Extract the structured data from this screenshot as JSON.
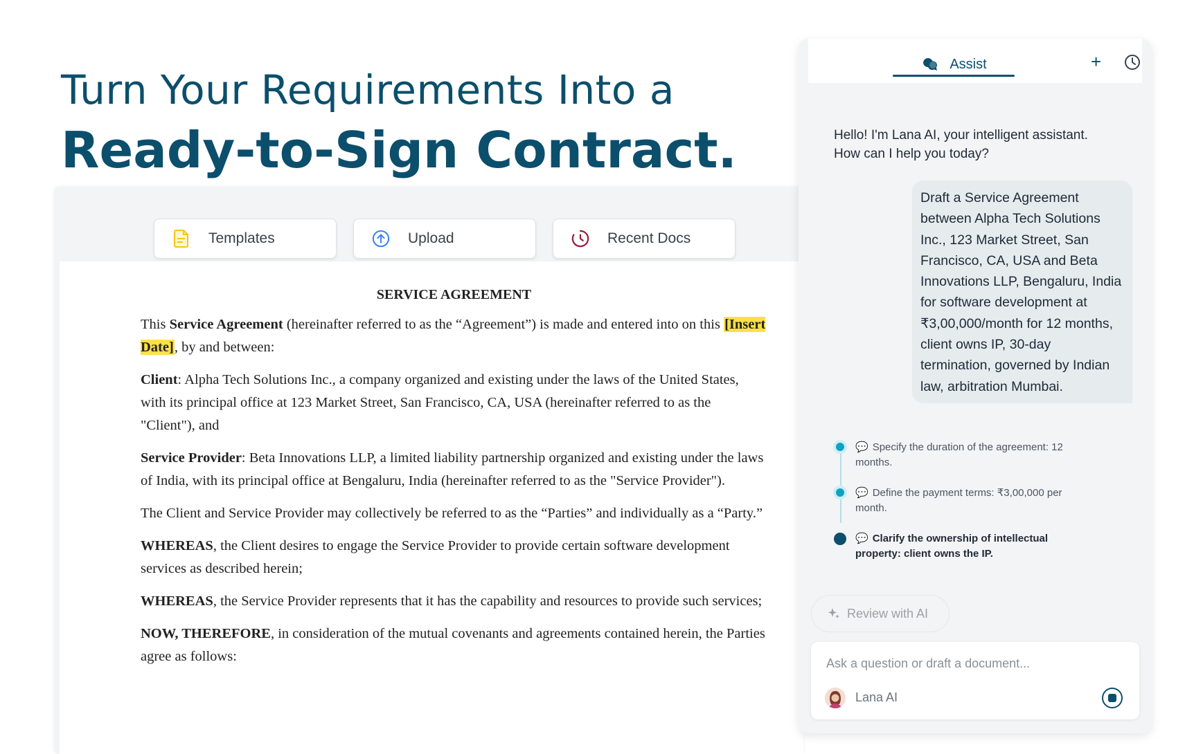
{
  "headline": {
    "line1": "Turn Your Requirements Into a",
    "line2": "Ready-to-Sign Contract."
  },
  "toolbar": {
    "templates": "Templates",
    "upload": "Upload",
    "recent_docs": "Recent Docs"
  },
  "document": {
    "title": "SERVICE AGREEMENT",
    "intro_a": "This ",
    "intro_bold": "Service Agreement",
    "intro_b": " (hereinafter referred to as the “Agreement”) is made and entered into on this ",
    "insert_date": "[Insert Date]",
    "intro_c": ", by and between:",
    "client_label": "Client",
    "client_text": ": Alpha Tech Solutions Inc., a company organized and existing under the laws of the United States, with its principal office at 123 Market Street, San Francisco, CA, USA (hereinafter referred to as the \"Client\"), and",
    "provider_label": "Service Provider",
    "provider_text": ": Beta Innovations LLP, a limited liability partnership organized and existing under the laws of India, with its principal office at Bengaluru, India (hereinafter referred to as the \"Service Provider\").",
    "parties_text": "The Client and Service Provider may collectively be referred to as the “Parties” and individually as a “Party.”",
    "whereas1_label": "WHEREAS",
    "whereas1_text": ", the Client desires to engage the Service Provider to provide certain software development services as described herein;",
    "whereas2_label": "WHEREAS",
    "whereas2_text": ", the Service Provider represents that it has the capability and resources to provide such services;",
    "now_label": "NOW, THEREFORE",
    "now_text": ", in consideration of the mutual covenants and agreements contained herein, the Parties agree as follows:"
  },
  "chat": {
    "tab_label": "Assist",
    "new_label": "+",
    "greeting_line1": "Hello! I'm Lana AI, your intelligent assistant.",
    "greeting_line2": "How can I help you today?",
    "user_message": "Draft a Service Agreement between Alpha Tech Solutions Inc., 123 Market Street, San Francisco, CA, USA and Beta Innovations LLP, Bengaluru, India for software development at ₹3,00,000/month for 12 months, client owns IP, 30-day termination, governed by Indian law, arbitration Mumbai.",
    "steps": [
      {
        "text": "Specify the duration of the agreement: 12 months.",
        "active": false
      },
      {
        "text": "Define the payment terms: ₹3,00,000 per month.",
        "active": false
      },
      {
        "text": "Clarify the ownership of intellectual property: client owns the IP.",
        "active": true
      }
    ],
    "review_button": "Review with AI",
    "input_placeholder": "Ask a question or draft a document...",
    "agent_name": "Lana AI"
  },
  "colors": {
    "brand": "#0b4f6c",
    "highlight": "#fde047",
    "step_dot": "#0fa3c2"
  }
}
